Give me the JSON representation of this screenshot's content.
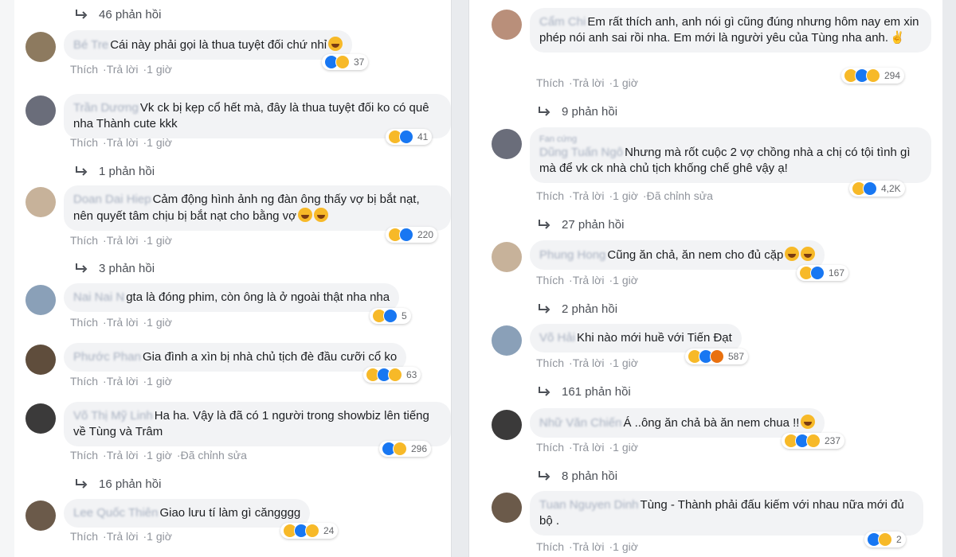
{
  "common": {
    "like": "Thích",
    "reply": "Trả lời",
    "time": "1 giờ",
    "edited": "Đã chỉnh sửa"
  },
  "left": [
    {
      "kind": "replies",
      "text": "46 phản hồi"
    },
    {
      "kind": "comment",
      "name": "Bé Tre",
      "text": "Cái này phải gọi là thua tuyệt đối chứ nhỉ",
      "emoji": 1,
      "count": "37",
      "reactions": [
        "like",
        "haha"
      ]
    },
    {
      "kind": "comment",
      "name": "Trần Dương",
      "text": "Vk ck bị kẹp cổ hết mà, đây là thua tuyệt đối ko có quê nha Thành cute kkk",
      "count": "41",
      "reactions": [
        "haha",
        "like"
      ]
    },
    {
      "kind": "replies",
      "text": "1 phản hồi"
    },
    {
      "kind": "comment",
      "name": "Doan Dai Hiep",
      "text": "Cảm động hình ảnh ng đàn ông thấy vợ bị bắt nạt, nên quyết tâm chịu bị bắt nạt cho bằng vợ",
      "emoji": 2,
      "count": "220",
      "reactions": [
        "haha",
        "like"
      ]
    },
    {
      "kind": "replies",
      "text": "3 phản hồi"
    },
    {
      "kind": "comment",
      "name": "Nai Nai N",
      "text": "gta là đóng phim, còn ông là ở ngoài thật nha nha",
      "count": "5",
      "reactions": [
        "haha",
        "like"
      ]
    },
    {
      "kind": "comment",
      "name": "Phước Phan",
      "text": "Gia đình a xìn bị nhà chủ tịch đè đầu cưỡi cổ ko",
      "count": "63",
      "reactions": [
        "haha",
        "like",
        "sad"
      ]
    },
    {
      "kind": "comment",
      "name": "Võ Thị Mỹ Linh",
      "text": "Ha ha. Vậy là đã có 1 người trong showbiz lên tiếng về Tùng và Trâm",
      "count": "296",
      "reactions": [
        "like",
        "haha"
      ],
      "edited": true
    },
    {
      "kind": "replies",
      "text": "16 phản hồi"
    },
    {
      "kind": "comment",
      "name": "Lee Quốc Thiên",
      "text": "Giao lưu tí làm gì căngggg",
      "count": "24",
      "reactions": [
        "haha",
        "like",
        "sad"
      ]
    }
  ],
  "right": [
    {
      "kind": "comment",
      "name": "Cẩm Chi",
      "text": "Em rất thích anh, anh nói gì cũng đúng nhưng hôm nay em xin phép nói anh sai rồi nha. Em mới là người yêu của Tùng nha anh.",
      "hand": true,
      "count": "294",
      "reactions": [
        "haha",
        "like",
        "sad"
      ]
    },
    {
      "kind": "replies",
      "text": "9 phản hồi"
    },
    {
      "kind": "comment",
      "name": "Dũng Tuấn Ngô",
      "fan": "Fan cứng",
      "text": "Nhưng mà rốt cuộc 2 vợ chồng nhà a chị có tội tình gì mà để vk ck nhà chủ tịch khống chế ghê vậy ạ!",
      "count": "4,2K",
      "reactions": [
        "haha",
        "like"
      ],
      "edited": true
    },
    {
      "kind": "replies",
      "text": "27 phản hồi"
    },
    {
      "kind": "comment",
      "name": "Phung Hong",
      "text": "Cũng ăn chả, ăn nem cho đủ cặp",
      "emoji": 2,
      "count": "167",
      "reactions": [
        "haha",
        "like"
      ]
    },
    {
      "kind": "replies",
      "text": "2 phản hồi"
    },
    {
      "kind": "comment",
      "name": "Võ Hải",
      "text": "Khi nào mới huề với Tiến Đạt",
      "count": "587",
      "reactions": [
        "haha",
        "like",
        "angry"
      ]
    },
    {
      "kind": "replies",
      "text": "161 phản hồi"
    },
    {
      "kind": "comment",
      "name": "Nhữ Văn Chiến",
      "text": "Á ..ông ăn chả bà ăn nem chua !!",
      "emoji": 1,
      "count": "237",
      "reactions": [
        "haha",
        "like",
        "sad"
      ]
    },
    {
      "kind": "replies",
      "text": "8 phản hồi"
    },
    {
      "kind": "comment",
      "name": "Tuan Nguyen Dinh",
      "text": "Tùng - Thành phải đấu kiếm với nhau nữa mới đủ bộ .",
      "count": "2",
      "reactions": [
        "like",
        "haha"
      ]
    }
  ]
}
